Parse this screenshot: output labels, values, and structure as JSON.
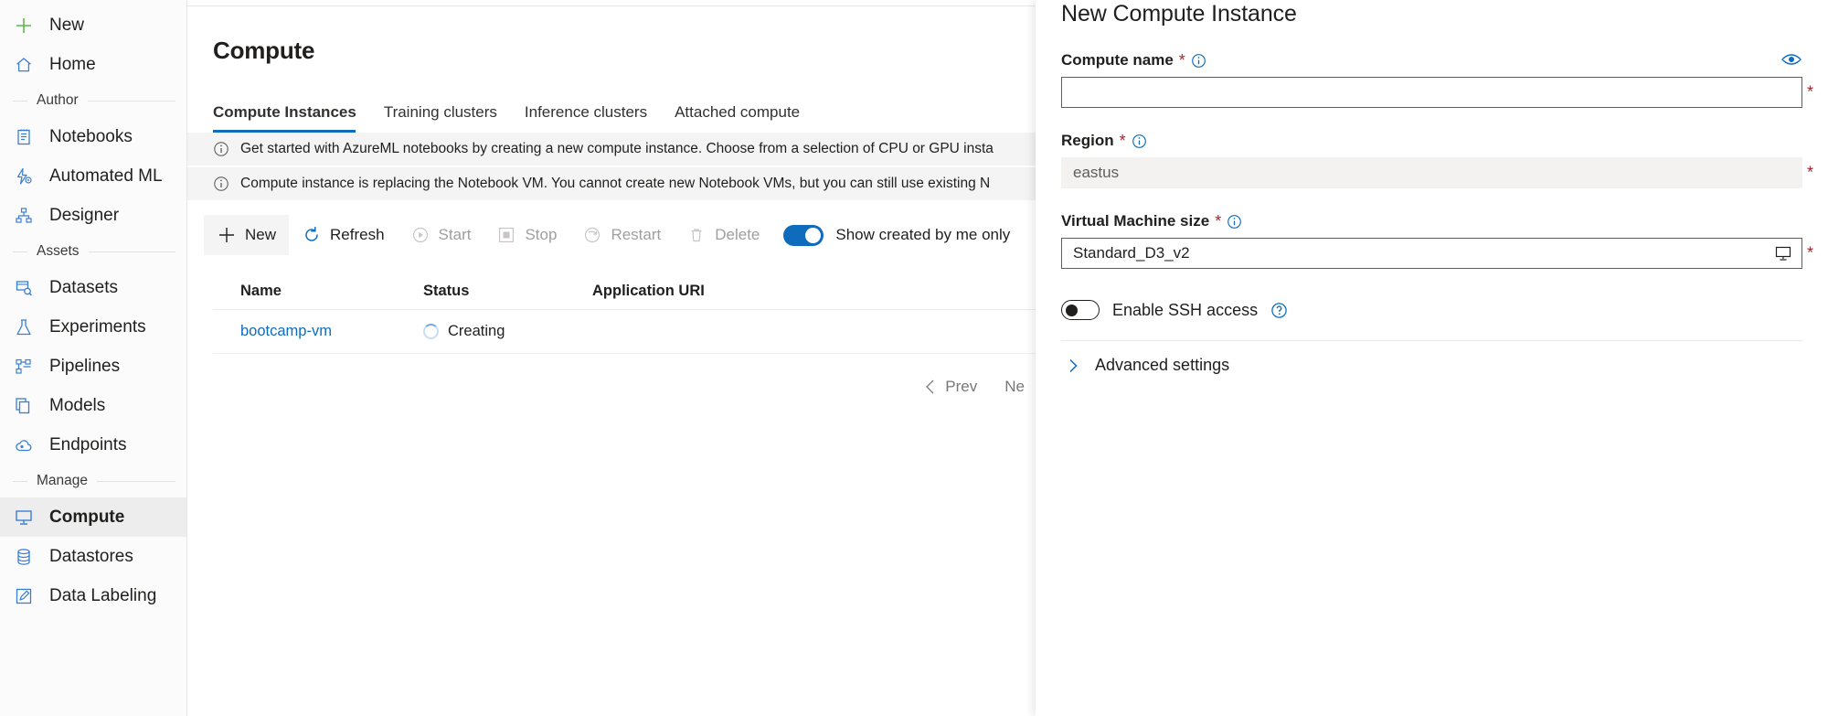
{
  "sidebar": {
    "items": [
      {
        "label": "New",
        "icon": "plus-icon",
        "type": "item",
        "selected": false
      },
      {
        "label": "Home",
        "icon": "home-icon",
        "type": "item",
        "selected": false
      },
      {
        "label": "Author",
        "type": "group"
      },
      {
        "label": "Notebooks",
        "icon": "notebook-icon",
        "type": "item",
        "selected": false
      },
      {
        "label": "Automated ML",
        "icon": "automated-ml-icon",
        "type": "item",
        "selected": false
      },
      {
        "label": "Designer",
        "icon": "designer-icon",
        "type": "item",
        "selected": false
      },
      {
        "label": "Assets",
        "type": "group"
      },
      {
        "label": "Datasets",
        "icon": "datasets-icon",
        "type": "item",
        "selected": false
      },
      {
        "label": "Experiments",
        "icon": "experiments-icon",
        "type": "item",
        "selected": false
      },
      {
        "label": "Pipelines",
        "icon": "pipelines-icon",
        "type": "item",
        "selected": false
      },
      {
        "label": "Models",
        "icon": "models-icon",
        "type": "item",
        "selected": false
      },
      {
        "label": "Endpoints",
        "icon": "endpoints-icon",
        "type": "item",
        "selected": false
      },
      {
        "label": "Manage",
        "type": "group"
      },
      {
        "label": "Compute",
        "icon": "compute-icon",
        "type": "item",
        "selected": true
      },
      {
        "label": "Datastores",
        "icon": "datastores-icon",
        "type": "item",
        "selected": false
      },
      {
        "label": "Data Labeling",
        "icon": "data-labeling-icon",
        "type": "item",
        "selected": false
      }
    ]
  },
  "main": {
    "page_title": "Compute",
    "tabs": [
      {
        "label": "Compute Instances",
        "active": true
      },
      {
        "label": "Training clusters",
        "active": false
      },
      {
        "label": "Inference clusters",
        "active": false
      },
      {
        "label": "Attached compute",
        "active": false
      }
    ],
    "banners": [
      "Get started with AzureML notebooks by creating a new compute instance. Choose from a selection of CPU or GPU insta",
      "Compute instance is replacing the Notebook VM. You cannot create new Notebook VMs, but you can still use existing N"
    ],
    "toolbar": {
      "new_label": "New",
      "refresh_label": "Refresh",
      "start_label": "Start",
      "stop_label": "Stop",
      "restart_label": "Restart",
      "delete_label": "Delete",
      "show_created_by_me_label": "Show created by me only",
      "show_created_by_me_on": true
    },
    "table": {
      "columns": [
        "Name",
        "Status",
        "Application URI"
      ],
      "rows": [
        {
          "name": "bootcamp-vm",
          "status": "Creating",
          "application_uri": ""
        }
      ]
    },
    "pagination": {
      "prev_label": "Prev",
      "next_label": "Ne"
    }
  },
  "panel": {
    "title": "New Compute Instance",
    "compute_name": {
      "label": "Compute name",
      "required_mark": "*",
      "value": "",
      "placeholder": ""
    },
    "region": {
      "label": "Region",
      "required_mark": "*",
      "value": "eastus",
      "disabled": true
    },
    "vm_size": {
      "label": "Virtual Machine size",
      "required_mark": "*",
      "value": "Standard_D3_v2"
    },
    "ssh": {
      "label": "Enable SSH access",
      "enabled": false
    },
    "advanced": {
      "label": "Advanced settings",
      "expanded": false
    }
  },
  "colors": {
    "accent": "#0f6cbd",
    "icon_blue": "#3b7fd4",
    "green": "#5eb848",
    "required_red": "#a4262c",
    "sidebar_bg": "#fbfbfb",
    "banner_bg": "#f4f4f4"
  }
}
